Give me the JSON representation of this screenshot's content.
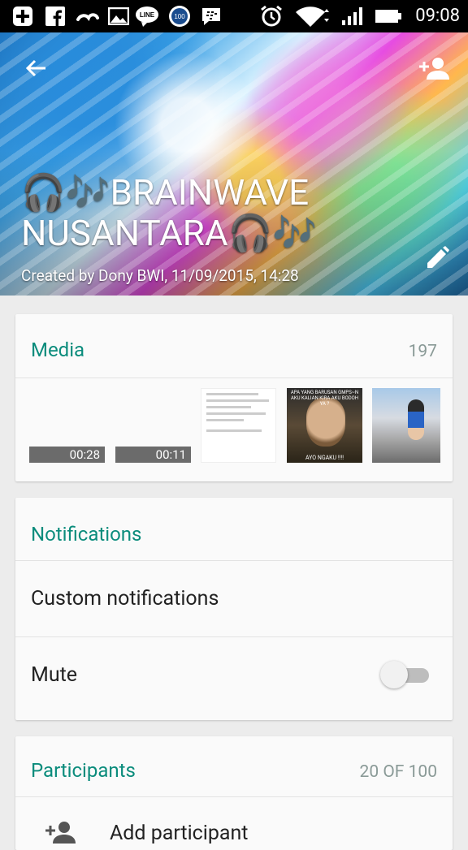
{
  "status_bar": {
    "time": "09:08",
    "badge_100": "100",
    "line_label": "LINE",
    "icons": [
      "plus-box-icon",
      "facebook-icon",
      "cloud-icon",
      "photo-icon",
      "line-icon",
      "badge-100-icon",
      "bbm-icon",
      "alarm-icon",
      "wifi-icon",
      "signal-icon",
      "battery-icon"
    ]
  },
  "header": {
    "title": "🎧🎶BRAINWAVE NUSANTARA🎧🎶",
    "created": "Created by Dony BWI, 11/09/2015, 14:28",
    "icons": [
      "back-arrow-icon",
      "add-person-icon",
      "edit-pencil-icon"
    ]
  },
  "media": {
    "title": "Media",
    "count": "197",
    "videos": [
      {
        "duration": "00:28"
      },
      {
        "duration": "00:11"
      }
    ],
    "photo_captions": {
      "top": "APA YANG BARUSAN GMPS~N AKU KALIAN KIRA AKU BODOH YA ?",
      "bottom": "AYO NGAKU !!!!"
    }
  },
  "notifications": {
    "title": "Notifications",
    "custom": "Custom notifications",
    "mute": "Mute",
    "mute_on": false
  },
  "participants": {
    "title": "Participants",
    "count": "20 OF 100",
    "add": "Add participant"
  },
  "colors": {
    "accent": "#0b8c7c",
    "background": "#ececec",
    "card": "#fafafa"
  }
}
